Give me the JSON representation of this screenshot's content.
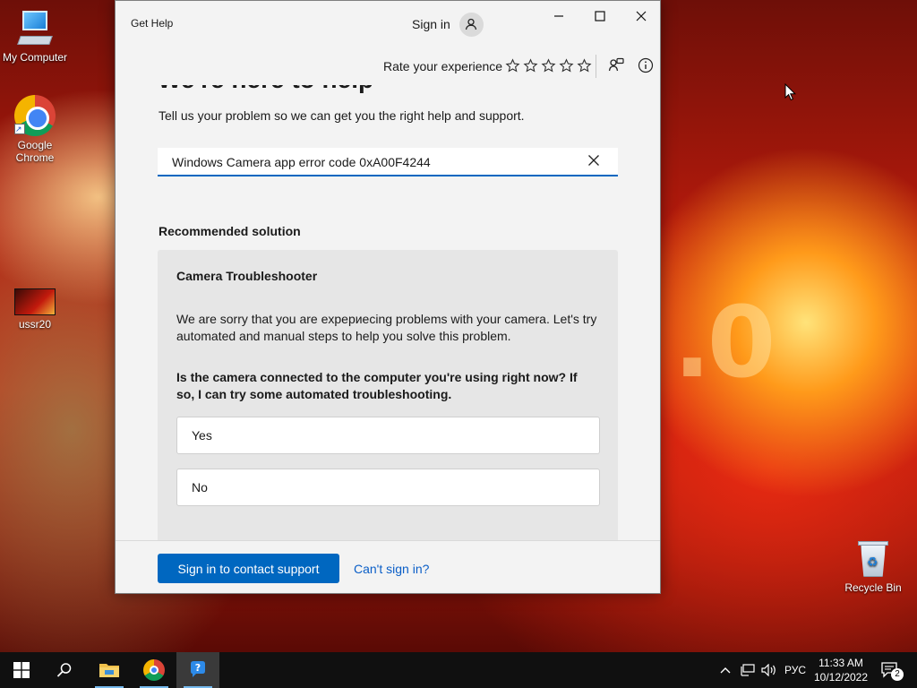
{
  "desktop": {
    "icons": [
      {
        "label": "My Computer",
        "icon": "computer-icon"
      },
      {
        "label": "Google Chrome",
        "icon": "chrome-icon"
      },
      {
        "label": "ussr20",
        "icon": "app-shortcut-icon"
      },
      {
        "label": "Recycle Bin",
        "icon": "recycle-bin-icon"
      }
    ],
    "wallpaper_text": ".0"
  },
  "window": {
    "title": "Get Help",
    "sign_in_label": "Sign in",
    "rate_label": "Rate your experience",
    "stars_count": 5,
    "hero_title": "We're here to help",
    "subtitle": "Tell us your problem so we can get you the right help and support.",
    "search": {
      "value": "Windows Camera app error code 0xA00F4244",
      "clear_icon": "close-icon"
    },
    "recommended_title": "Recommended solution",
    "card": {
      "title": "Camera Troubleshooter",
      "description": "We are sorry that you are expериecing problems with your camera. Let's try automated and manual steps to help you solve this problem.",
      "question": "Is the camera connected to the computer you're using right now? If so, I can try some automated troubleshooting.",
      "answers": [
        "Yes",
        "No"
      ]
    },
    "footer": {
      "primary_button": "Sign in to contact support",
      "link": "Can't sign in?"
    }
  },
  "taskbar": {
    "language": "РУС",
    "time": "11:33 AM",
    "date": "10/12/2022",
    "notification_count": "2"
  },
  "colors": {
    "accent": "#0067c0",
    "link": "#0a5ec7",
    "taskbar": "#101010"
  }
}
